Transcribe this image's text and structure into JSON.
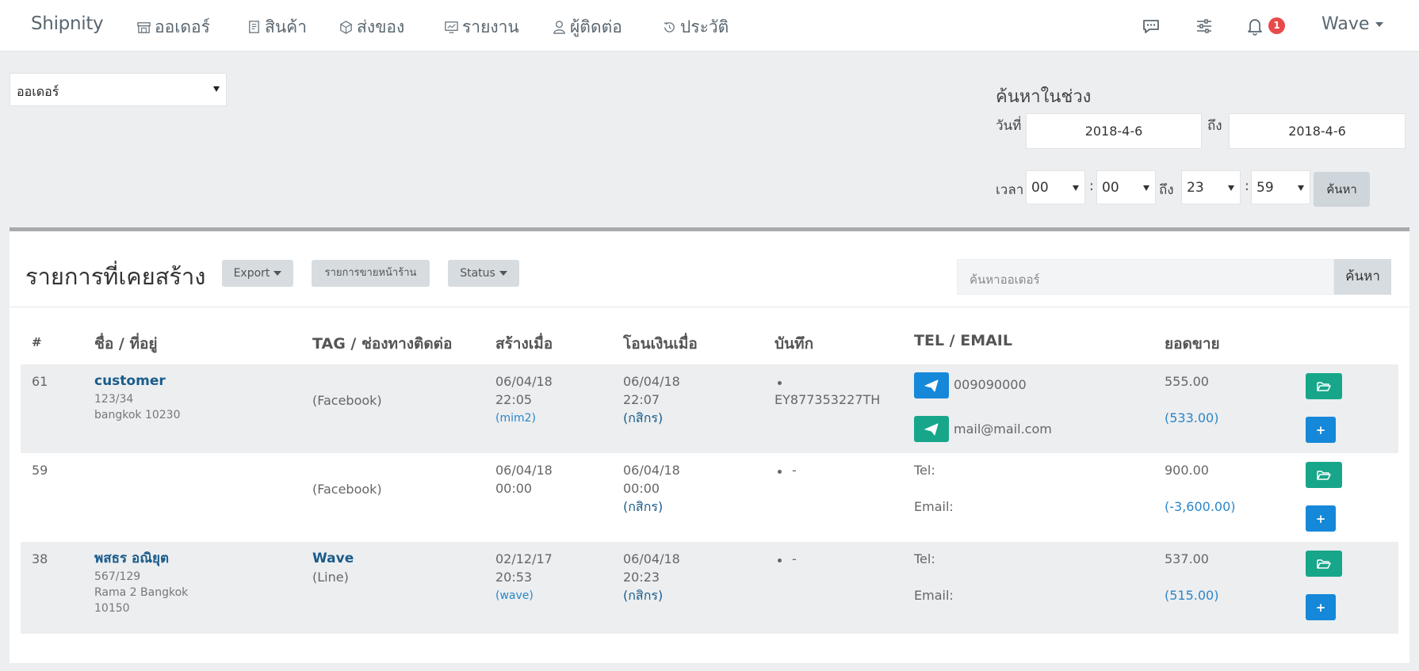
{
  "nav": {
    "brand": "Shipnity",
    "items": [
      {
        "label": "ออเดอร์",
        "icon": "store-icon"
      },
      {
        "label": "สินค้า",
        "icon": "product-icon"
      },
      {
        "label": "ส่งของ",
        "icon": "box-icon"
      },
      {
        "label": "รายงาน",
        "icon": "report-icon"
      },
      {
        "label": "ผู้ติดต่อ",
        "icon": "user-icon"
      },
      {
        "label": "ประวัติ",
        "icon": "history-icon"
      }
    ],
    "notification_count": "1",
    "user": "Wave"
  },
  "filters": {
    "type_select": "ออเดอร์",
    "range_title": "ค้นหาในช่วง",
    "date_label": "วันที่",
    "to_label": "ถึง",
    "date_from": "2018-4-6",
    "date_to": "2018-4-6",
    "time_label": "เวลา",
    "time_from_h": "00",
    "time_from_m": "00",
    "time_to_label": "ถึง",
    "time_to_h": "23",
    "time_to_m": "59",
    "search_label": "ค้นหา"
  },
  "panel": {
    "title": "รายการที่เคยสร้าง",
    "export_label": "Export",
    "pos_label": "รายการขายหน้าร้าน",
    "status_label": "Status",
    "search_placeholder": "ค้นหาออเดอร์",
    "search_button": "ค้นหา"
  },
  "table": {
    "headers": [
      "#",
      "ชื่อ / ที่อยู่",
      "TAG / ช่องทางติดต่อ",
      "สร้างเมื่อ",
      "โอนเงินเมื่อ",
      "บันทึก",
      "TEL / EMAIL",
      "ยอดขาย"
    ],
    "rows": [
      {
        "id": "61",
        "name": "customer",
        "address": [
          "123/34",
          "bangkok 10230"
        ],
        "tag": "",
        "channel": "(Facebook)",
        "created_date": "06/04/18",
        "created_time": "22:05",
        "created_by": "(mim2)",
        "paid_date": "06/04/18",
        "paid_time": "22:07",
        "bank": "(กสิกร)",
        "note": "EY877353227TH",
        "tel": "009090000",
        "email": "mail@mail.com",
        "total": "555.00",
        "net": "(533.00)"
      },
      {
        "id": "59",
        "name": "",
        "address": [],
        "tag": "",
        "channel": "(Facebook)",
        "created_date": "06/04/18",
        "created_time": "00:00",
        "created_by": "",
        "paid_date": "06/04/18",
        "paid_time": "00:00",
        "bank": "(กสิกร)",
        "note": "-",
        "tel_label": "Tel:",
        "email_label": "Email:",
        "total": "900.00",
        "net": "(-3,600.00)"
      },
      {
        "id": "38",
        "name": "พสธร อณิยุต",
        "address": [
          "567/129",
          "Rama 2 Bangkok",
          "10150"
        ],
        "tag": "Wave",
        "channel": "(Line)",
        "created_date": "02/12/17",
        "created_time": "20:53",
        "created_by": "(wave)",
        "paid_date": "06/04/18",
        "paid_time": "20:23",
        "bank": "(กสิกร)",
        "note": "-",
        "tel_label": "Tel:",
        "email_label": "Email:",
        "total": "537.00",
        "net": "(515.00)"
      }
    ]
  },
  "colors": {
    "teal": "#17a68a",
    "blue": "#1588d9",
    "badge": "#e84a4a",
    "link": "#2b86c8"
  }
}
